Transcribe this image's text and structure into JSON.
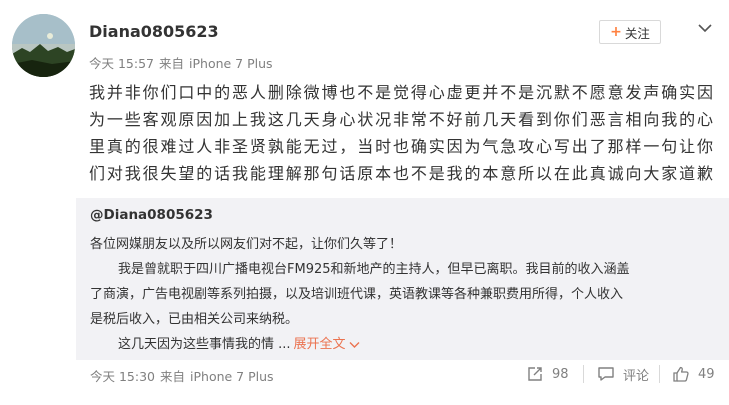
{
  "post": {
    "username": "Diana0805623",
    "time": "今天 15:57",
    "source_prefix": "来自",
    "source": "iPhone 7 Plus",
    "follow_label": "关注",
    "lines": [
      "我并非你们口中的恶人删除微博也不是觉得心虚更并不是沉默不愿意发声确实因",
      "为一些客观原因加上我这几天身心状况非常不好前几天看到你们恶言相向我的心",
      "里真的很难过人非圣贤孰能无过，当时也确实因为气急攻心写出了那样一句让你",
      "们对我很失望的话我能理解那句话原本也不是我的本意所以在此真诚向大家道歉"
    ]
  },
  "quote": {
    "username": "@Diana0805623",
    "line1": "各位网媒朋友以及所以网友们对不起，让你们久等了！",
    "line2": "我是曾就职于四川广播电视台FM925和新地产的主持人，但早已离职。我目前的收入涵盖",
    "line3": "了商演，广告电视剧等系列拍摄，以及培训班代课，英语教课等各种兼职费用所得，个人收入",
    "line4": "是税后收入，已由相关公司来纳税。",
    "line5": "这几天因为这些事情我的情 ...",
    "expand_label": "展开全文",
    "time": "今天 15:30",
    "source_prefix": "来自",
    "source": "iPhone 7 Plus",
    "repost_count": "98",
    "comment_label": "评论",
    "like_count": "49"
  },
  "icons": {
    "more": "chevron-down-icon",
    "repost": "repost-icon",
    "comment": "comment-icon",
    "like": "thumbs-up-icon"
  },
  "colors": {
    "accent": "#eb7350",
    "follow_plus": "#ff8140",
    "quote_bg": "#f2f2f5",
    "meta_text": "#808080"
  }
}
